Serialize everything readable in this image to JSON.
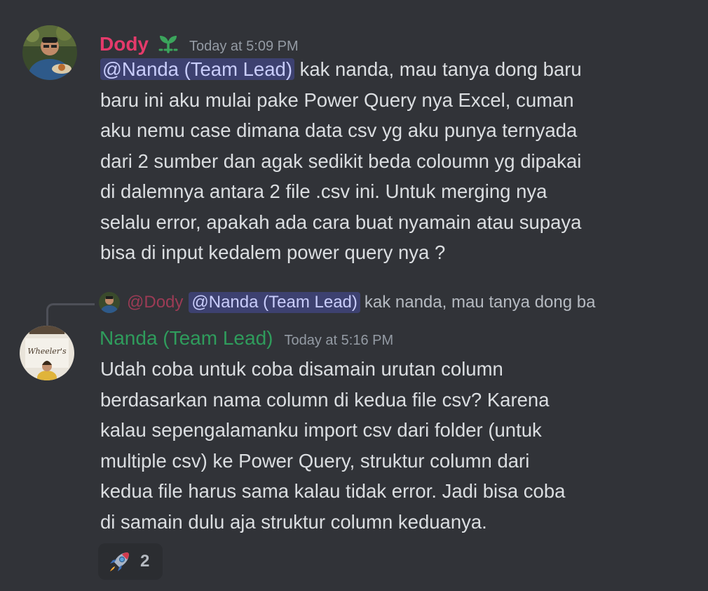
{
  "messages": [
    {
      "username": "Dody",
      "timestamp": "Today at 5:09 PM",
      "mention": "@Nanda (Team Lead)",
      "lines": [
        " kak nanda, mau tanya dong baru",
        "baru ini aku mulai pake Power Query nya Excel, cuman",
        "aku nemu case dimana data csv yg aku punya ternyada",
        "dari 2 sumber dan agak sedikit beda coloumn yg dipakai",
        "di dalemnya antara 2 file .csv ini. Untuk merging nya",
        "selalu error, apakah ada cara buat nyamain atau supaya",
        "bisa di input kedalem power query nya ?"
      ],
      "avatar_icon": "user-avatar-icon",
      "badge_icon": "sprout-badge-icon"
    },
    {
      "username": "Nanda (Team Lead)",
      "timestamp": "Today at 5:16 PM",
      "reply_preview": {
        "username": "@Dody",
        "mention": "@Nanda (Team Lead)",
        "text": "kak nanda, mau tanya dong ba"
      },
      "lines": [
        "Udah coba untuk coba disamain urutan column",
        "berdasarkan nama column di kedua file csv? Karena",
        "kalau sepengalamanku import csv dari folder (untuk",
        "multiple csv) ke Power Query, struktur column dari",
        "kedua file harus sama kalau tidak error. Jadi bisa coba",
        "di samain dulu aja struktur column keduanya."
      ],
      "avatar_sign_text": "Wheeler's",
      "reaction": {
        "emoji": "rocket-icon",
        "count": "2"
      }
    }
  ],
  "colors": {
    "background": "#313338",
    "dody_name": "#e53a6b",
    "nanda_name": "#2f9c5c",
    "mention_bg": "#4a4f8a",
    "text": "#dbdee1",
    "muted": "#949ba4"
  }
}
